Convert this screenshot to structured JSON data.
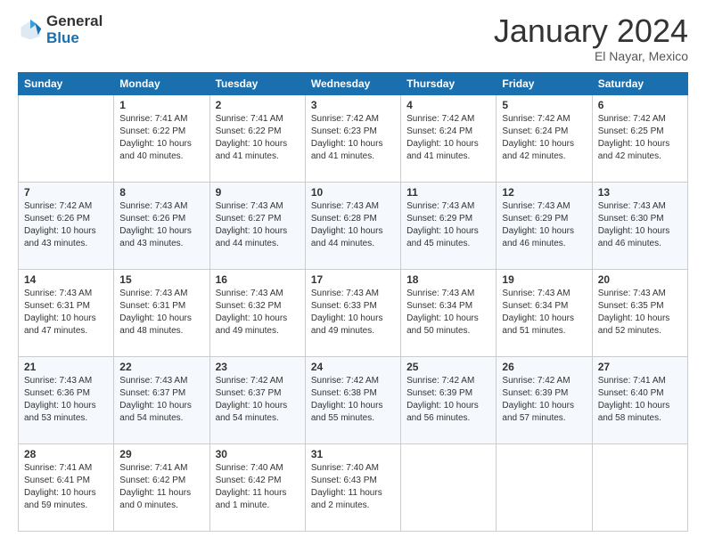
{
  "logo": {
    "general": "General",
    "blue": "Blue"
  },
  "header": {
    "month": "January 2024",
    "location": "El Nayar, Mexico"
  },
  "weekdays": [
    "Sunday",
    "Monday",
    "Tuesday",
    "Wednesday",
    "Thursday",
    "Friday",
    "Saturday"
  ],
  "weeks": [
    [
      {
        "day": "",
        "info": ""
      },
      {
        "day": "1",
        "info": "Sunrise: 7:41 AM\nSunset: 6:22 PM\nDaylight: 10 hours\nand 40 minutes."
      },
      {
        "day": "2",
        "info": "Sunrise: 7:41 AM\nSunset: 6:22 PM\nDaylight: 10 hours\nand 41 minutes."
      },
      {
        "day": "3",
        "info": "Sunrise: 7:42 AM\nSunset: 6:23 PM\nDaylight: 10 hours\nand 41 minutes."
      },
      {
        "day": "4",
        "info": "Sunrise: 7:42 AM\nSunset: 6:24 PM\nDaylight: 10 hours\nand 41 minutes."
      },
      {
        "day": "5",
        "info": "Sunrise: 7:42 AM\nSunset: 6:24 PM\nDaylight: 10 hours\nand 42 minutes."
      },
      {
        "day": "6",
        "info": "Sunrise: 7:42 AM\nSunset: 6:25 PM\nDaylight: 10 hours\nand 42 minutes."
      }
    ],
    [
      {
        "day": "7",
        "info": "Sunrise: 7:42 AM\nSunset: 6:26 PM\nDaylight: 10 hours\nand 43 minutes."
      },
      {
        "day": "8",
        "info": "Sunrise: 7:43 AM\nSunset: 6:26 PM\nDaylight: 10 hours\nand 43 minutes."
      },
      {
        "day": "9",
        "info": "Sunrise: 7:43 AM\nSunset: 6:27 PM\nDaylight: 10 hours\nand 44 minutes."
      },
      {
        "day": "10",
        "info": "Sunrise: 7:43 AM\nSunset: 6:28 PM\nDaylight: 10 hours\nand 44 minutes."
      },
      {
        "day": "11",
        "info": "Sunrise: 7:43 AM\nSunset: 6:29 PM\nDaylight: 10 hours\nand 45 minutes."
      },
      {
        "day": "12",
        "info": "Sunrise: 7:43 AM\nSunset: 6:29 PM\nDaylight: 10 hours\nand 46 minutes."
      },
      {
        "day": "13",
        "info": "Sunrise: 7:43 AM\nSunset: 6:30 PM\nDaylight: 10 hours\nand 46 minutes."
      }
    ],
    [
      {
        "day": "14",
        "info": "Sunrise: 7:43 AM\nSunset: 6:31 PM\nDaylight: 10 hours\nand 47 minutes."
      },
      {
        "day": "15",
        "info": "Sunrise: 7:43 AM\nSunset: 6:31 PM\nDaylight: 10 hours\nand 48 minutes."
      },
      {
        "day": "16",
        "info": "Sunrise: 7:43 AM\nSunset: 6:32 PM\nDaylight: 10 hours\nand 49 minutes."
      },
      {
        "day": "17",
        "info": "Sunrise: 7:43 AM\nSunset: 6:33 PM\nDaylight: 10 hours\nand 49 minutes."
      },
      {
        "day": "18",
        "info": "Sunrise: 7:43 AM\nSunset: 6:34 PM\nDaylight: 10 hours\nand 50 minutes."
      },
      {
        "day": "19",
        "info": "Sunrise: 7:43 AM\nSunset: 6:34 PM\nDaylight: 10 hours\nand 51 minutes."
      },
      {
        "day": "20",
        "info": "Sunrise: 7:43 AM\nSunset: 6:35 PM\nDaylight: 10 hours\nand 52 minutes."
      }
    ],
    [
      {
        "day": "21",
        "info": "Sunrise: 7:43 AM\nSunset: 6:36 PM\nDaylight: 10 hours\nand 53 minutes."
      },
      {
        "day": "22",
        "info": "Sunrise: 7:43 AM\nSunset: 6:37 PM\nDaylight: 10 hours\nand 54 minutes."
      },
      {
        "day": "23",
        "info": "Sunrise: 7:42 AM\nSunset: 6:37 PM\nDaylight: 10 hours\nand 54 minutes."
      },
      {
        "day": "24",
        "info": "Sunrise: 7:42 AM\nSunset: 6:38 PM\nDaylight: 10 hours\nand 55 minutes."
      },
      {
        "day": "25",
        "info": "Sunrise: 7:42 AM\nSunset: 6:39 PM\nDaylight: 10 hours\nand 56 minutes."
      },
      {
        "day": "26",
        "info": "Sunrise: 7:42 AM\nSunset: 6:39 PM\nDaylight: 10 hours\nand 57 minutes."
      },
      {
        "day": "27",
        "info": "Sunrise: 7:41 AM\nSunset: 6:40 PM\nDaylight: 10 hours\nand 58 minutes."
      }
    ],
    [
      {
        "day": "28",
        "info": "Sunrise: 7:41 AM\nSunset: 6:41 PM\nDaylight: 10 hours\nand 59 minutes."
      },
      {
        "day": "29",
        "info": "Sunrise: 7:41 AM\nSunset: 6:42 PM\nDaylight: 11 hours\nand 0 minutes."
      },
      {
        "day": "30",
        "info": "Sunrise: 7:40 AM\nSunset: 6:42 PM\nDaylight: 11 hours\nand 1 minute."
      },
      {
        "day": "31",
        "info": "Sunrise: 7:40 AM\nSunset: 6:43 PM\nDaylight: 11 hours\nand 2 minutes."
      },
      {
        "day": "",
        "info": ""
      },
      {
        "day": "",
        "info": ""
      },
      {
        "day": "",
        "info": ""
      }
    ]
  ]
}
